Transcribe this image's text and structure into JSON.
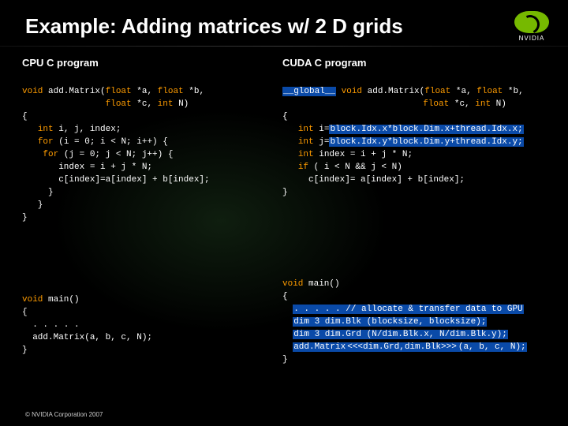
{
  "title": "Example: Adding matrices w/ 2 D grids",
  "brand": "NVIDIA",
  "columns": {
    "left_header": "CPU C program",
    "right_header": "CUDA C program"
  },
  "code": {
    "left_signature": {
      "l1a": "void",
      "l1b": " add.Matrix(",
      "l1c": "float",
      "l1d": " *a, ",
      "l1e": "float",
      "l1f": " *b,",
      "l2a": "                ",
      "l2b": "float",
      "l2c": " *c, ",
      "l2d": "int",
      "l2e": " N)"
    },
    "left_body": {
      "l3": "{",
      "l4a": "   ",
      "l4b": "int",
      "l4c": " i, j, index;",
      "l5a": "   ",
      "l5b": "for",
      "l5c": " (i = 0; i < N; i++) {",
      "l6a": "    ",
      "l6b": "for",
      "l6c": " (j = 0; j < N; j++) {",
      "l7": "       index = i + j * N;",
      "l8": "       c[index]=a[index] + b[index];",
      "l9": "     }",
      "l10": "   }",
      "l11": "}"
    },
    "left_main": {
      "m1a": "void",
      "m1b": " main()",
      "m2": "{",
      "m3": "  . . . . .",
      "m4": "  add.Matrix(a, b, c, N);",
      "m5": "}"
    },
    "right_signature": {
      "r1a": "__global__",
      "r1b": " ",
      "r1c": "void",
      "r1d": " add.Matrix(",
      "r1e": "float",
      "r1f": " *a, ",
      "r1g": "float",
      "r1h": " *b,",
      "r2a": "                           ",
      "r2b": "float",
      "r2c": " *c, ",
      "r2d": "int",
      "r2e": " N)"
    },
    "right_body": {
      "r3": "{",
      "r4a": "   ",
      "r4b": "int",
      "r4c": " i=",
      "r4d": "block.Idx.x*block.Dim.x+thread.Idx.x;",
      "r5a": "   ",
      "r5b": "int",
      "r5c": " j=",
      "r5d": "block.Idx.y*block.Dim.y+thread.Idx.y;",
      "r6a": "   ",
      "r6b": "int",
      "r6c": " index = i + j * N;",
      "r7a": "   ",
      "r7b": "if",
      "r7c": " ( i < N && j < N)",
      "r8": "     c[index]= a[index] + b[index];",
      "r9": "}"
    },
    "right_main": {
      "n1a": "void",
      "n1b": " main()",
      "n2": "{",
      "n3a": "  ",
      "n3b": ". . . . . // allocate & transfer data to GPU",
      "n4a": "  ",
      "n4b": "dim 3 dim.Blk (blocksize, blocksize);",
      "n5a": "  ",
      "n5b": "dim 3 dim.Grd (N/dim.Blk.x, N/dim.Blk.y);",
      "n6a": "  ",
      "n6b": "add.Matrix",
      "n6c": "<<<dim.Grd,dim.Blk>>>",
      "n6d": "(a, b, c, N);",
      "n7": "}"
    }
  },
  "copyright": "© NVIDIA Corporation 2007"
}
